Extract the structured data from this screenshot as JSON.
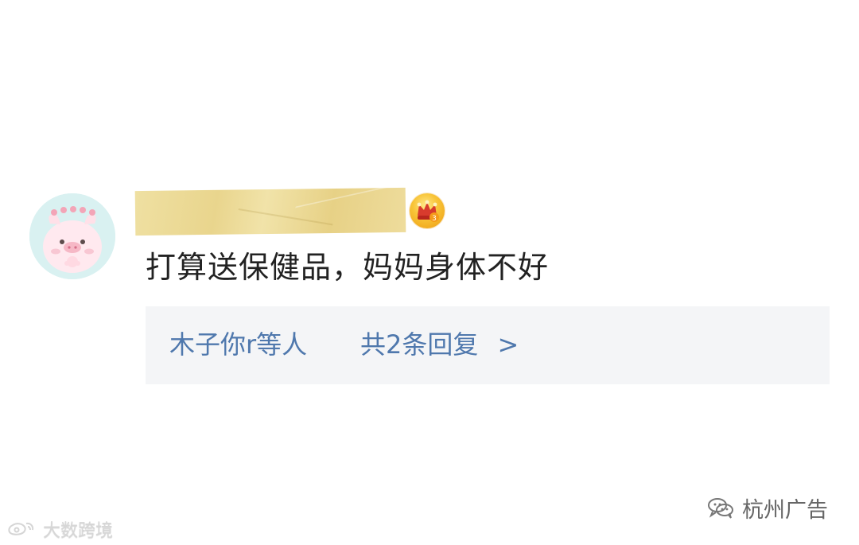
{
  "comment": {
    "avatar": {
      "icon": "pink-pig-avatar"
    },
    "username": "",
    "badge_icon": "crown-badge",
    "text": "打算送保健品，妈妈身体不好",
    "replies": {
      "users": "木子你r等人",
      "count_label": "共2条回复",
      "chevron": ">"
    }
  },
  "watermarks": {
    "left_text": "大数跨境",
    "right_text": "杭州广告",
    "left_icon": "weibo-icon",
    "right_icon": "wechat-icon"
  },
  "colors": {
    "reply_text": "#4f78ad",
    "reply_bg": "#f4f5f7",
    "comment_text": "#222222"
  }
}
